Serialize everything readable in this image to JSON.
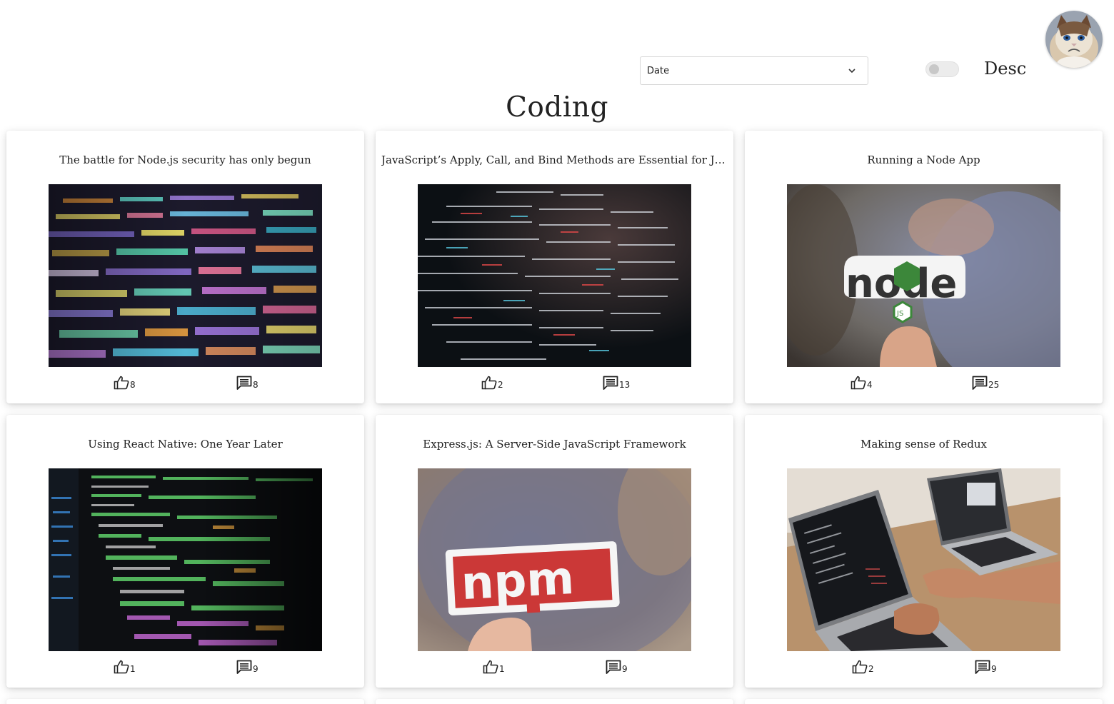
{
  "sort": {
    "selected": "Date"
  },
  "order": {
    "label": "Desc"
  },
  "avatar": {
    "icon": "grumpy-cat-avatar"
  },
  "page": {
    "title": "Coding"
  },
  "posts": [
    {
      "title": "The battle for Node.js security has only begun",
      "likes": "8",
      "comments": "8",
      "image": "colorful-code-screen"
    },
    {
      "title": "JavaScript’s Apply, Call, and Bind Methods are Essential for JavaScript Professionals",
      "likes": "2",
      "comments": "13",
      "image": "dark-code-screen"
    },
    {
      "title": "Running a Node App",
      "likes": "4",
      "comments": "25",
      "image": "node-sticker"
    },
    {
      "title": "Using React Native: One Year Later",
      "likes": "1",
      "comments": "9",
      "image": "green-code-editor"
    },
    {
      "title": "Express.js: A Server-Side JavaScript Framework",
      "likes": "1",
      "comments": "9",
      "image": "npm-sticker"
    },
    {
      "title": "Making sense of Redux",
      "likes": "2",
      "comments": "9",
      "image": "laptops-on-desk"
    }
  ],
  "colors": {
    "text": "#222222",
    "card_bg": "#ffffff",
    "page_bg": "#ffffff",
    "npm_red": "#cb3837",
    "node_green": "#3c873a"
  }
}
